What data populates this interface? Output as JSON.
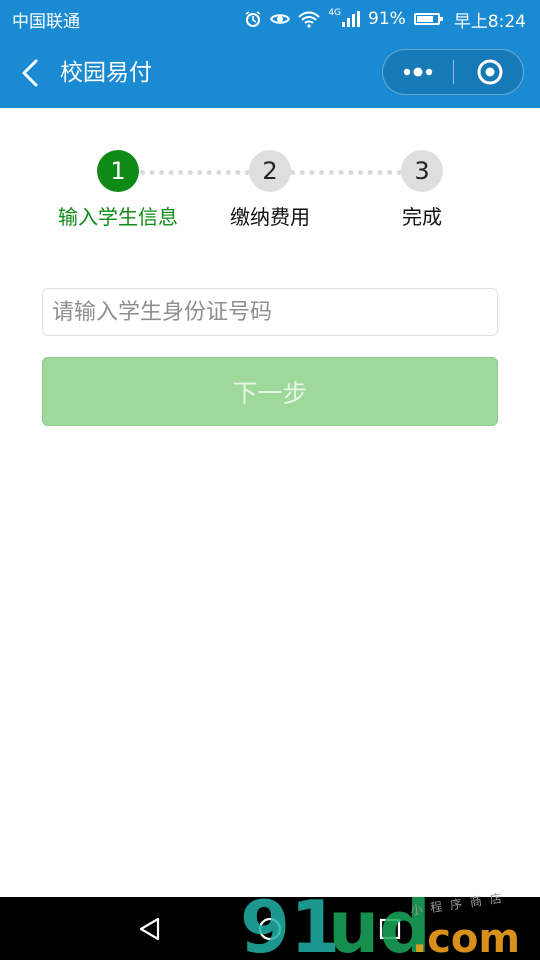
{
  "status_bar": {
    "carrier": "中国联通",
    "network": "4G",
    "battery_text": "91%",
    "battery_level": 0.91,
    "time": "早上8:24",
    "icons": [
      "alarm-icon",
      "eye-icon",
      "wifi-icon",
      "signal-icon",
      "battery-icon"
    ]
  },
  "nav": {
    "title": "校园易付",
    "back_icon": "chevron-left-icon",
    "more_icon": "more-dots-icon",
    "close_icon": "target-close-icon",
    "bg_color": "#1a8bd3"
  },
  "steps": [
    {
      "number": "1",
      "label": "输入学生信息",
      "state": "active"
    },
    {
      "number": "2",
      "label": "缴纳费用",
      "state": "todo"
    },
    {
      "number": "3",
      "label": "完成",
      "state": "todo"
    }
  ],
  "form": {
    "id_placeholder": "请输入学生身份证号码",
    "id_value": "",
    "next_label": "下一步"
  },
  "colors": {
    "active_step": "#0f8a16",
    "inactive_step": "#dedede",
    "button_disabled": "#9ed99b"
  },
  "android_nav": {
    "back_icon": "triangle-back-icon",
    "home_icon": "circle-home-icon",
    "recents_icon": "square-recents-icon"
  },
  "watermark": {
    "logo_text": "91ud.com",
    "caption": "小程序商店"
  }
}
